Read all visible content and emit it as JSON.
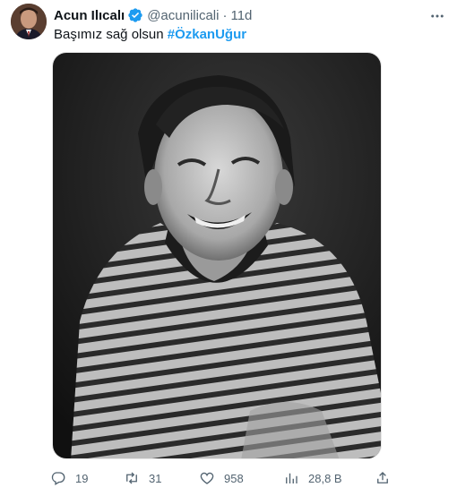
{
  "author": {
    "name": "Acun Ilıcalı",
    "handle": "@acunilicali",
    "separator": "·",
    "time": "11d"
  },
  "tweet": {
    "text": "Başımız sağ olsun ",
    "hashtag": "#ÖzkanUğur"
  },
  "actions": {
    "replies": "19",
    "retweets": "31",
    "likes": "958",
    "views": "28,8 B"
  },
  "colors": {
    "accent": "#1d9bf0",
    "secondary_text": "#536471",
    "primary_text": "#0f1419"
  },
  "icons": {
    "verified": "verified-badge-icon",
    "more": "more-dots-icon",
    "reply": "reply-icon",
    "retweet": "retweet-icon",
    "like": "heart-icon",
    "views": "views-bar-chart-icon",
    "share": "share-icon"
  }
}
